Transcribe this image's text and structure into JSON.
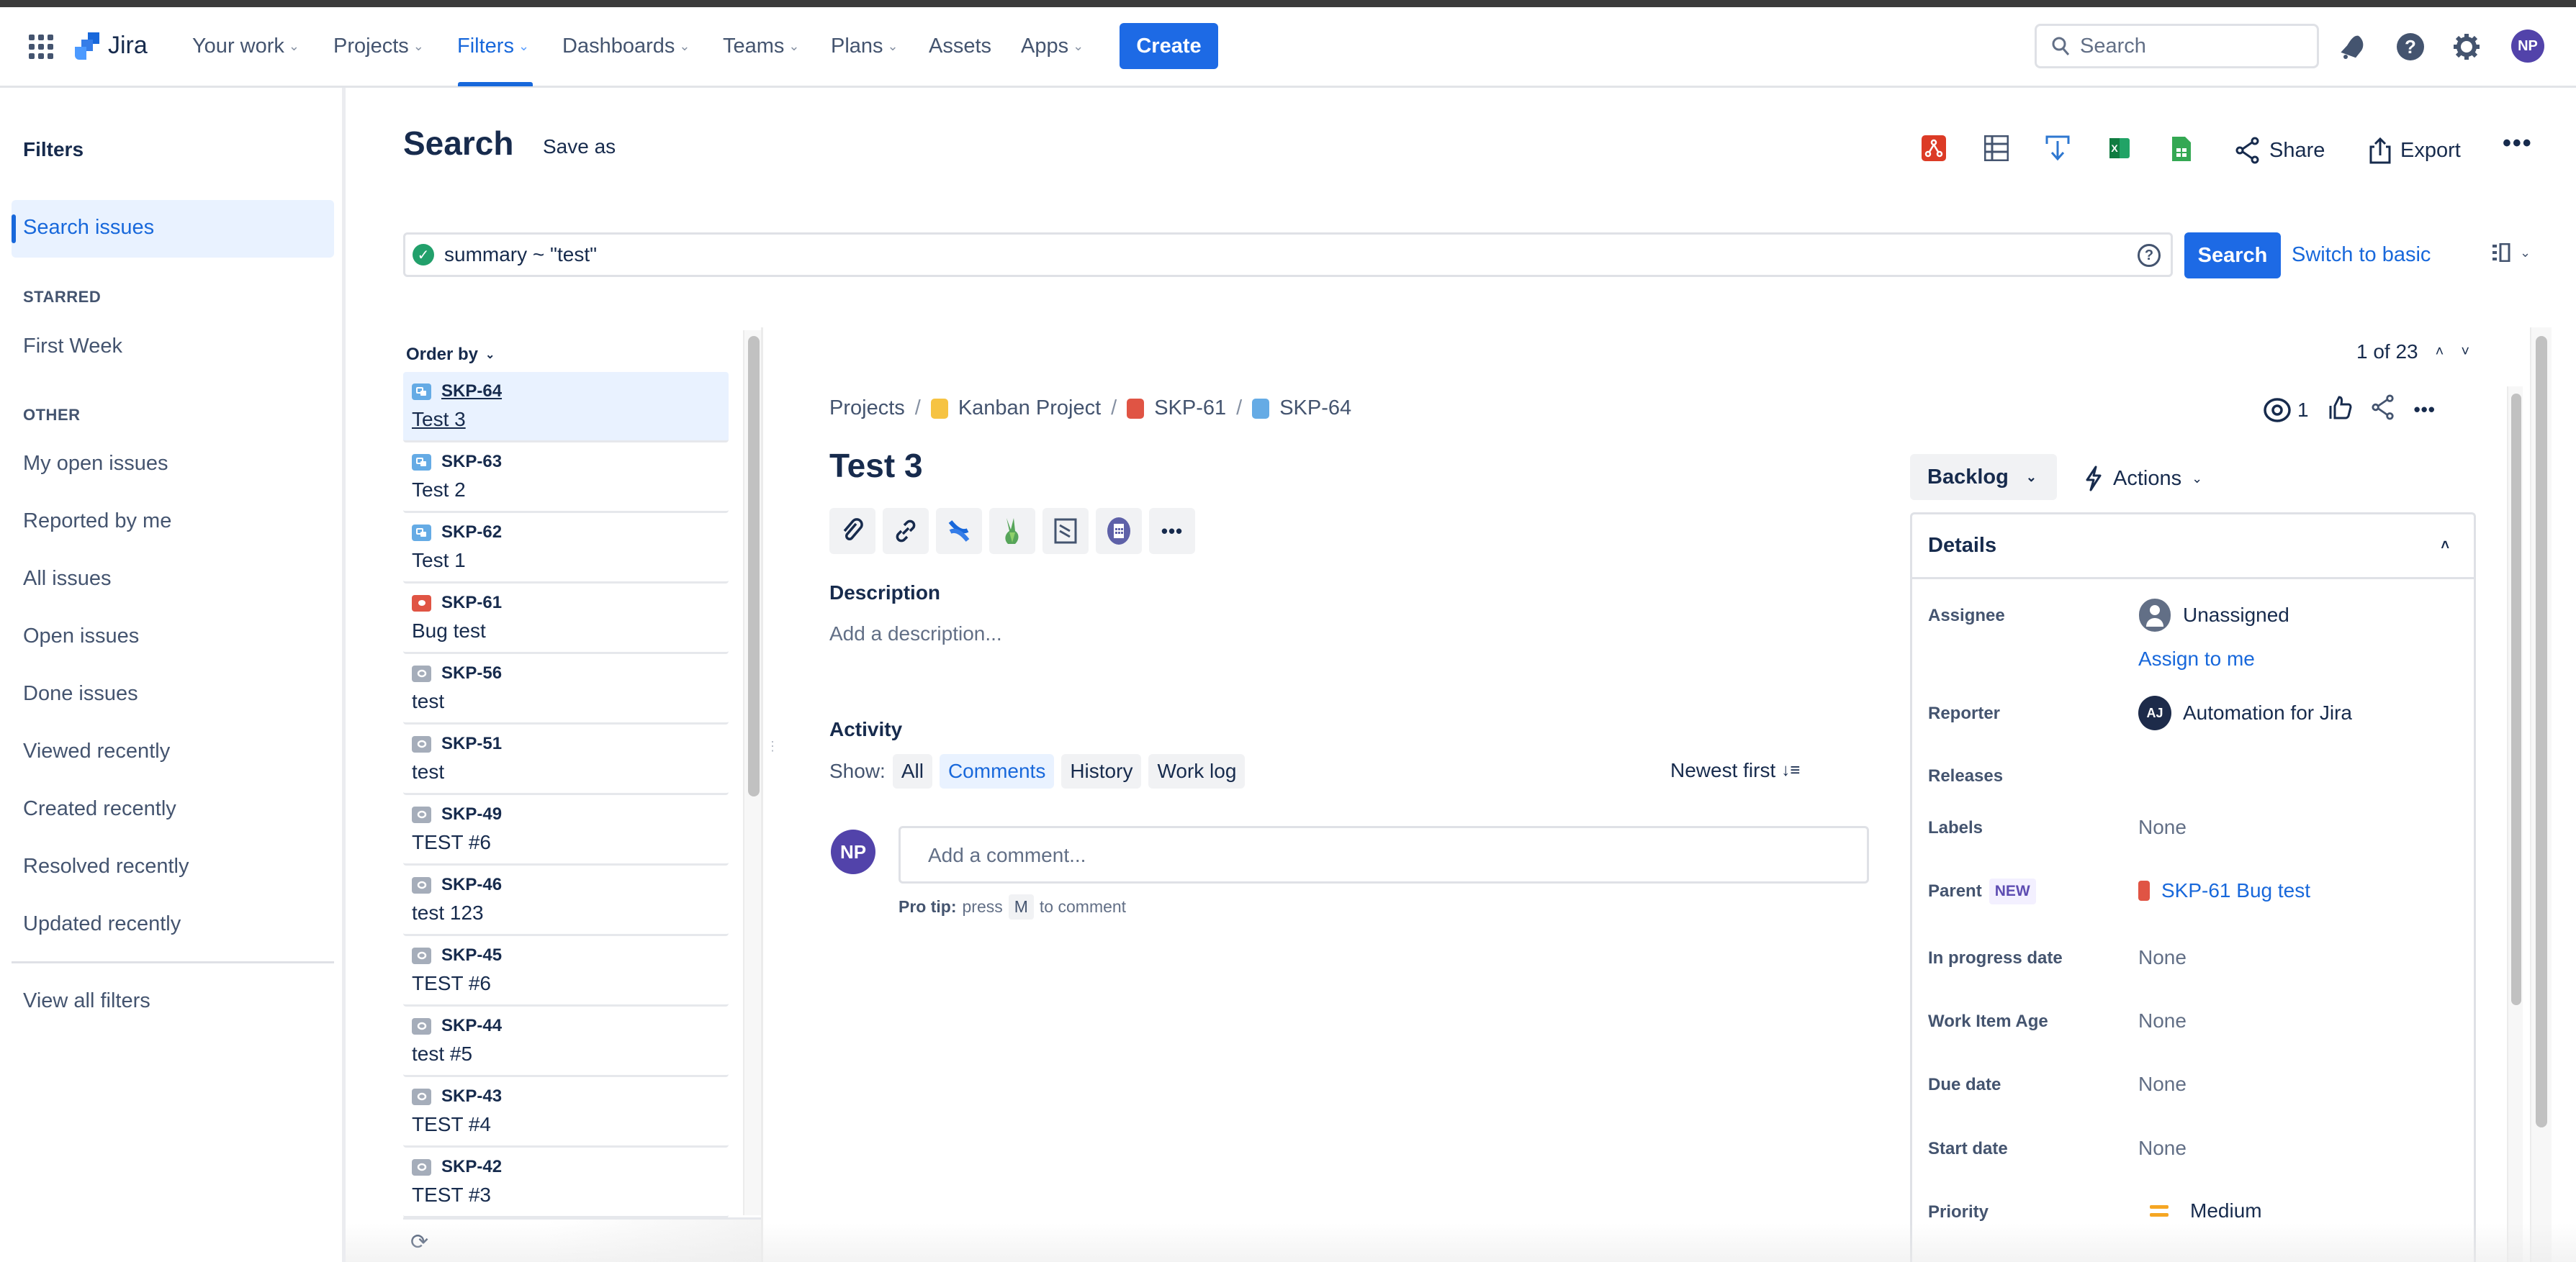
{
  "nav": {
    "product": "Jira",
    "items": [
      {
        "label": "Your work",
        "dropdown": true
      },
      {
        "label": "Projects",
        "dropdown": true
      },
      {
        "label": "Filters",
        "dropdown": true,
        "active": true
      },
      {
        "label": "Dashboards",
        "dropdown": true
      },
      {
        "label": "Teams",
        "dropdown": true
      },
      {
        "label": "Plans",
        "dropdown": true
      },
      {
        "label": "Assets",
        "dropdown": false
      },
      {
        "label": "Apps",
        "dropdown": true
      }
    ],
    "create_label": "Create",
    "search_placeholder": "Search",
    "user_initials": "NP",
    "accent": "#1868db"
  },
  "sidebar": {
    "title": "Filters",
    "active_item": "Search issues",
    "starred_heading": "STARRED",
    "starred": [
      "First Week"
    ],
    "other_heading": "OTHER",
    "other": [
      "My open issues",
      "Reported by me",
      "All issues",
      "Open issues",
      "Done issues",
      "Viewed recently",
      "Created recently",
      "Resolved recently",
      "Updated recently"
    ],
    "view_all": "View all filters"
  },
  "header": {
    "title": "Search",
    "save_as": "Save as",
    "share": "Share",
    "export": "Export"
  },
  "jql": {
    "query": "summary ~ \"test\"",
    "search_button": "Search",
    "switch_label": "Switch to basic"
  },
  "list": {
    "order_by": "Order by",
    "issues": [
      {
        "key": "SKP-64",
        "summary": "Test 3",
        "type": "subtask",
        "selected": true
      },
      {
        "key": "SKP-63",
        "summary": "Test 2",
        "type": "subtask"
      },
      {
        "key": "SKP-62",
        "summary": "Test 1",
        "type": "subtask"
      },
      {
        "key": "SKP-61",
        "summary": "Bug test",
        "type": "bug"
      },
      {
        "key": "SKP-56",
        "summary": "test",
        "type": "task"
      },
      {
        "key": "SKP-51",
        "summary": "test",
        "type": "task"
      },
      {
        "key": "SKP-49",
        "summary": "TEST #6",
        "type": "task"
      },
      {
        "key": "SKP-46",
        "summary": "test 123",
        "type": "task"
      },
      {
        "key": "SKP-45",
        "summary": "TEST #6",
        "type": "task"
      },
      {
        "key": "SKP-44",
        "summary": "test #5",
        "type": "task"
      },
      {
        "key": "SKP-43",
        "summary": "TEST #4",
        "type": "task"
      },
      {
        "key": "SKP-42",
        "summary": "TEST #3",
        "type": "task"
      }
    ]
  },
  "detail": {
    "pager": "1 of 23",
    "breadcrumbs": [
      "Projects",
      "Kanban Project",
      "SKP-61",
      "SKP-64"
    ],
    "title": "Test 3",
    "watchers": "1",
    "description_label": "Description",
    "description_placeholder": "Add a description...",
    "activity_label": "Activity",
    "show_label": "Show:",
    "filters": [
      "All",
      "Comments",
      "History",
      "Work log"
    ],
    "active_filter": "Comments",
    "sort_label": "Newest first",
    "comment_placeholder": "Add a comment...",
    "pro_tip_bold": "Pro tip:",
    "pro_tip_press": "press",
    "pro_tip_key": "M",
    "pro_tip_rest": "to comment",
    "status": "Backlog",
    "actions": "Actions",
    "details_heading": "Details",
    "fields": {
      "assignee_label": "Assignee",
      "assignee": "Unassigned",
      "assign_to_me": "Assign to me",
      "reporter_label": "Reporter",
      "reporter": "Automation for Jira",
      "reporter_initials": "AJ",
      "releases_label": "Releases",
      "labels_label": "Labels",
      "labels": "None",
      "parent_label": "Parent",
      "parent_badge": "NEW",
      "parent": "SKP-61 Bug test",
      "in_progress_label": "In progress date",
      "in_progress": "None",
      "age_label": "Work Item Age",
      "age": "None",
      "due_label": "Due date",
      "due": "None",
      "start_label": "Start date",
      "start": "None",
      "priority_label": "Priority",
      "priority": "Medium",
      "priority_color": "#f5a623"
    }
  }
}
